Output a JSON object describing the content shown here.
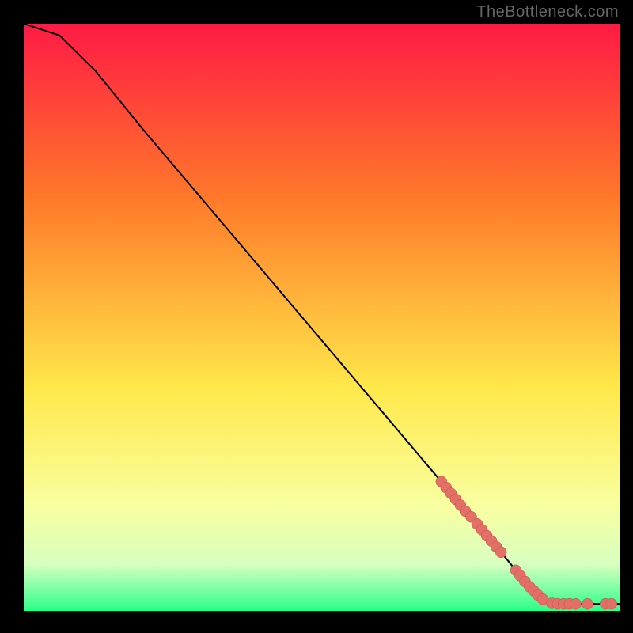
{
  "watermark": "TheBottleneck.com",
  "colors": {
    "bg_black": "#000000",
    "grad_top": "#ff1a44",
    "grad_mid1": "#ff7a2a",
    "grad_mid2": "#ffe84a",
    "grad_low1": "#f8ffa0",
    "grad_low2": "#d8ffc0",
    "grad_bottom": "#2aff8a",
    "curve_stroke": "#000000",
    "marker_fill": "#e27066",
    "marker_stroke": "#c44d47"
  },
  "chart_data": {
    "type": "line",
    "title": "",
    "xlabel": "",
    "ylabel": "",
    "xlim": [
      0,
      100
    ],
    "ylim": [
      0,
      100
    ],
    "curve": [
      {
        "x": 0,
        "y": 100
      },
      {
        "x": 6,
        "y": 98
      },
      {
        "x": 12,
        "y": 92
      },
      {
        "x": 20,
        "y": 82
      },
      {
        "x": 30,
        "y": 70
      },
      {
        "x": 40,
        "y": 58
      },
      {
        "x": 50,
        "y": 46
      },
      {
        "x": 60,
        "y": 34
      },
      {
        "x": 70,
        "y": 22
      },
      {
        "x": 75,
        "y": 16
      },
      {
        "x": 80,
        "y": 10
      },
      {
        "x": 84,
        "y": 5
      },
      {
        "x": 87,
        "y": 2
      },
      {
        "x": 90,
        "y": 1.2
      },
      {
        "x": 95,
        "y": 1.2
      },
      {
        "x": 100,
        "y": 1.2
      }
    ],
    "markers": [
      {
        "x": 70.0,
        "y": 22.0
      },
      {
        "x": 70.8,
        "y": 21.0
      },
      {
        "x": 71.6,
        "y": 20.0
      },
      {
        "x": 72.4,
        "y": 19.0
      },
      {
        "x": 73.2,
        "y": 18.0
      },
      {
        "x": 74.0,
        "y": 17.0
      },
      {
        "x": 75.0,
        "y": 16.0
      },
      {
        "x": 76.0,
        "y": 14.8
      },
      {
        "x": 76.8,
        "y": 13.8
      },
      {
        "x": 77.6,
        "y": 12.8
      },
      {
        "x": 78.4,
        "y": 11.9
      },
      {
        "x": 79.2,
        "y": 10.9
      },
      {
        "x": 80.0,
        "y": 10.0
      },
      {
        "x": 82.5,
        "y": 6.9
      },
      {
        "x": 83.2,
        "y": 6.0
      },
      {
        "x": 84.0,
        "y": 5.0
      },
      {
        "x": 84.8,
        "y": 4.1
      },
      {
        "x": 85.5,
        "y": 3.4
      },
      {
        "x": 86.2,
        "y": 2.7
      },
      {
        "x": 87.0,
        "y": 2.0
      },
      {
        "x": 88.5,
        "y": 1.3
      },
      {
        "x": 89.5,
        "y": 1.2
      },
      {
        "x": 90.5,
        "y": 1.2
      },
      {
        "x": 91.5,
        "y": 1.2
      },
      {
        "x": 92.5,
        "y": 1.2
      },
      {
        "x": 94.5,
        "y": 1.2
      },
      {
        "x": 97.5,
        "y": 1.2
      },
      {
        "x": 98.5,
        "y": 1.2
      }
    ]
  }
}
